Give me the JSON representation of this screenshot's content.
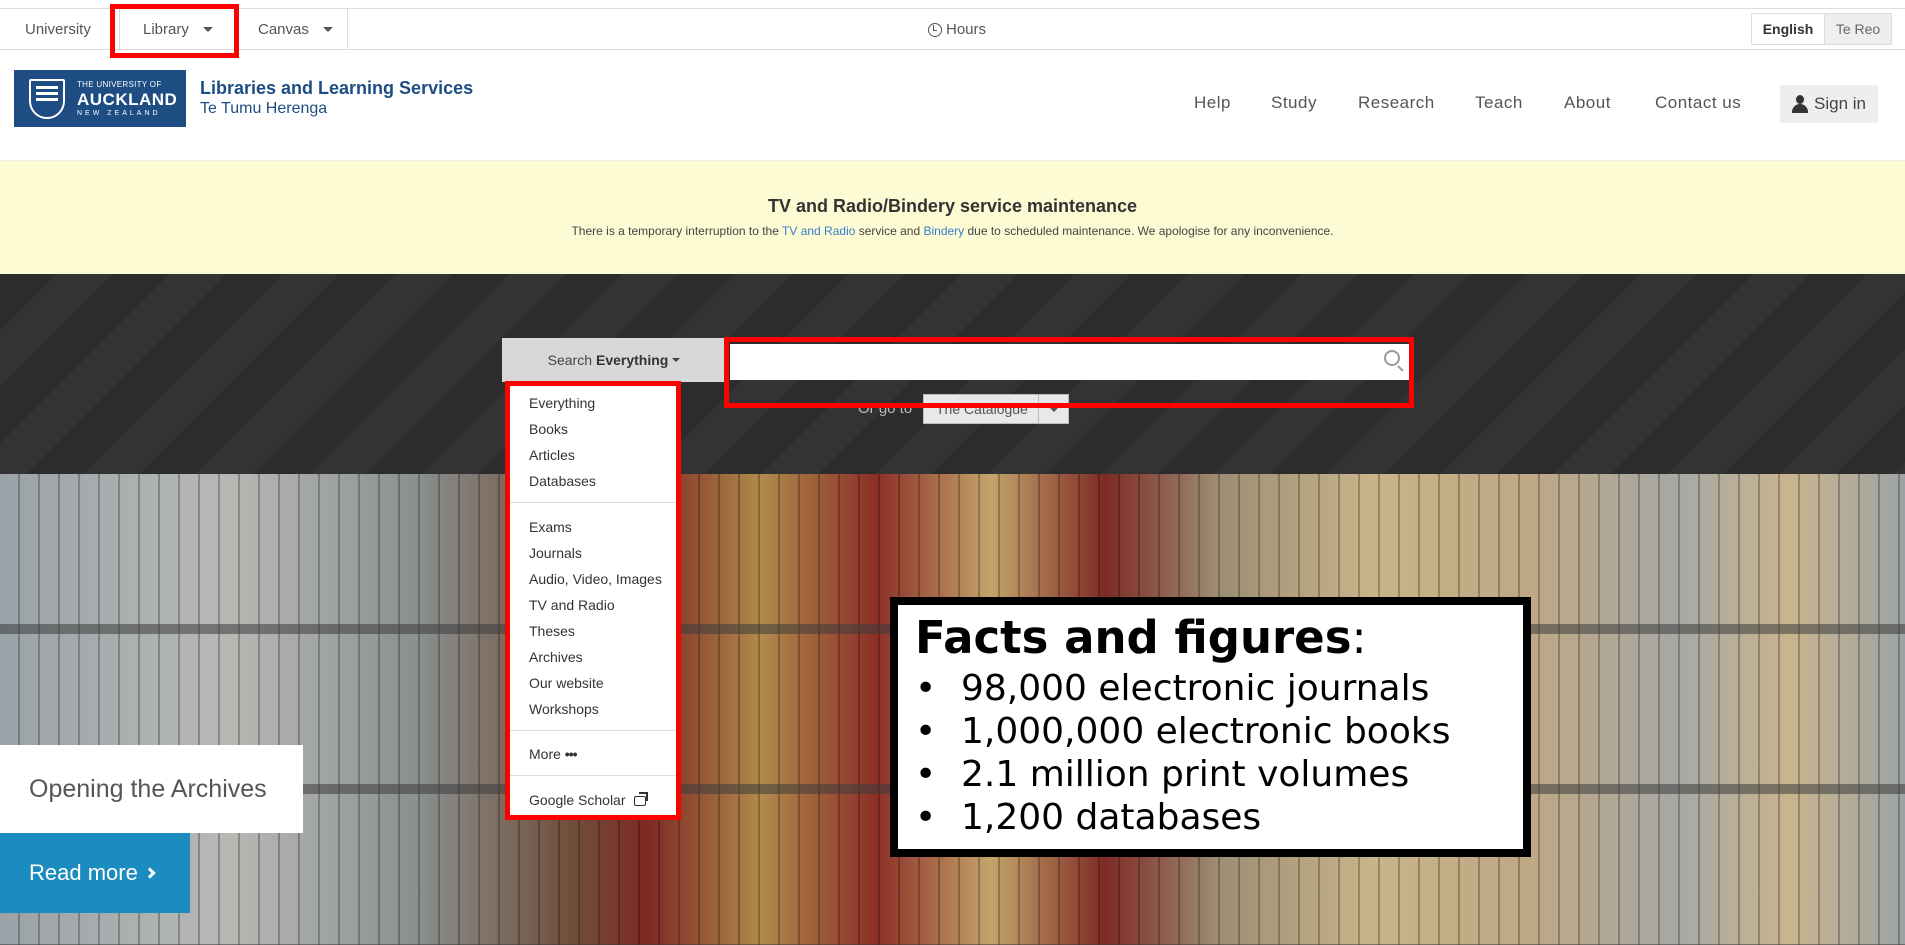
{
  "topbar": {
    "university": "University",
    "library": "Library",
    "canvas": "Canvas",
    "hours": "Hours",
    "lang_english": "English",
    "lang_tereo": "Te Reo"
  },
  "logo": {
    "line1": "THE UNIVERSITY OF",
    "line2": "AUCKLAND",
    "line3": "NEW ZEALAND"
  },
  "site": {
    "title": "Libraries and Learning Services",
    "subtitle": "Te Tumu Herenga"
  },
  "nav": [
    "Help",
    "Study",
    "Research",
    "Teach",
    "About",
    "Contact us"
  ],
  "signin": "Sign in",
  "alert": {
    "title": "TV and Radio/Bindery service maintenance",
    "text_before": "There is a temporary interruption to the ",
    "link1": "TV and Radio",
    "text_mid": " service and ",
    "link2": "Bindery",
    "text_after": " due to scheduled maintenance. We apologise for any inconvenience."
  },
  "search": {
    "button_prefix": "Search",
    "button_scope": "Everything",
    "input_value": "",
    "or_go_to": "Or go to",
    "catalogue": "The Catalogue"
  },
  "dropdown": {
    "group1": [
      "Everything",
      "Books",
      "Articles",
      "Databases"
    ],
    "group2": [
      "Exams",
      "Journals",
      "Audio, Video, Images",
      "TV and Radio",
      "Theses",
      "Archives",
      "Our website",
      "Workshops"
    ],
    "more": "More",
    "google_scholar": "Google Scholar"
  },
  "hero": {
    "title": "Opening the Archives",
    "read_more": "Read more"
  },
  "facts": {
    "title": "Facts and figures",
    "items": [
      "98,000 electronic journals",
      "1,000,000 electronic books",
      "2.1 million print volumes",
      "1,200 databases"
    ]
  },
  "colors": {
    "brand_blue": "#1d4d83",
    "highlight_red": "#ff0000",
    "alert_bg": "#fcfbd4",
    "read_more_bg": "#1b8cbf"
  }
}
